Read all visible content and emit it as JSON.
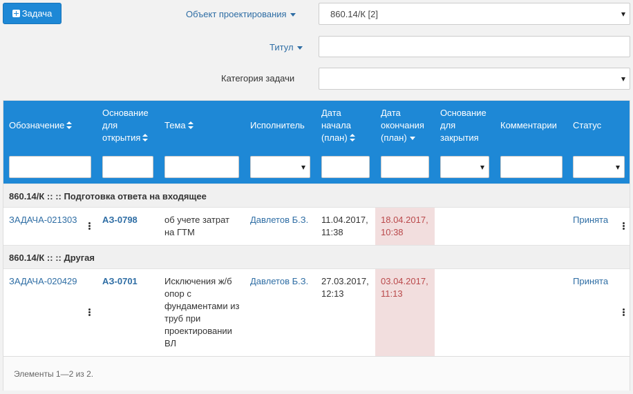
{
  "toolbar": {
    "add_task_label": "Задача"
  },
  "filters": {
    "project_object_label": "Объект проектирования",
    "project_object_value": "860.14/К [2]",
    "title_label": "Титул",
    "title_value": "",
    "category_label": "Категория задачи",
    "category_value": ""
  },
  "table": {
    "columns": [
      {
        "key": "designation",
        "label": "Обозначение",
        "sort": "both"
      },
      {
        "key": "basis_open",
        "label": "Основание для открытия",
        "sort": "both"
      },
      {
        "key": "subject",
        "label": "Тема",
        "sort": "both"
      },
      {
        "key": "assignee",
        "label": "Исполнитель",
        "sort": "none"
      },
      {
        "key": "start",
        "label": "Дата начала (план)",
        "sort": "both"
      },
      {
        "key": "end",
        "label": "Дата окончания (план)",
        "sort": "desc"
      },
      {
        "key": "basis_close",
        "label": "Основание для закрытия",
        "sort": "none"
      },
      {
        "key": "comments",
        "label": "Комментарии",
        "sort": "none"
      },
      {
        "key": "status",
        "label": "Статус",
        "sort": "none"
      }
    ],
    "groups": [
      {
        "label": "860.14/К ::  :: Подготовка ответа на входящее",
        "rows": [
          {
            "designation": "ЗАДАЧА-021303",
            "basis_open": "АЗ-0798",
            "subject": "об учете затрат на ГТМ",
            "assignee": "Давлетов Б.З.",
            "start": "11.04.2017, 11:38",
            "end": "18.04.2017, 10:38",
            "basis_close": "",
            "comments": "",
            "status": "Принята"
          }
        ]
      },
      {
        "label": "860.14/К ::  :: Другая",
        "rows": [
          {
            "designation": "ЗАДАЧА-020429",
            "basis_open": "АЗ-0701",
            "subject": "Исключения ж/б опор с фундаментами из труб при проектировании ВЛ",
            "assignee": "Давлетов Б.З.",
            "start": "27.03.2017, 12:13",
            "end": "03.04.2017, 11:13",
            "basis_close": "",
            "comments": "",
            "status": "Принята"
          }
        ]
      }
    ],
    "footer": "Элементы 1—2 из 2."
  },
  "colors": {
    "header_bg": "#1e88d6",
    "link": "#2e6da4",
    "overdue_bg": "#f2dede",
    "overdue_text": "#b9484a"
  }
}
